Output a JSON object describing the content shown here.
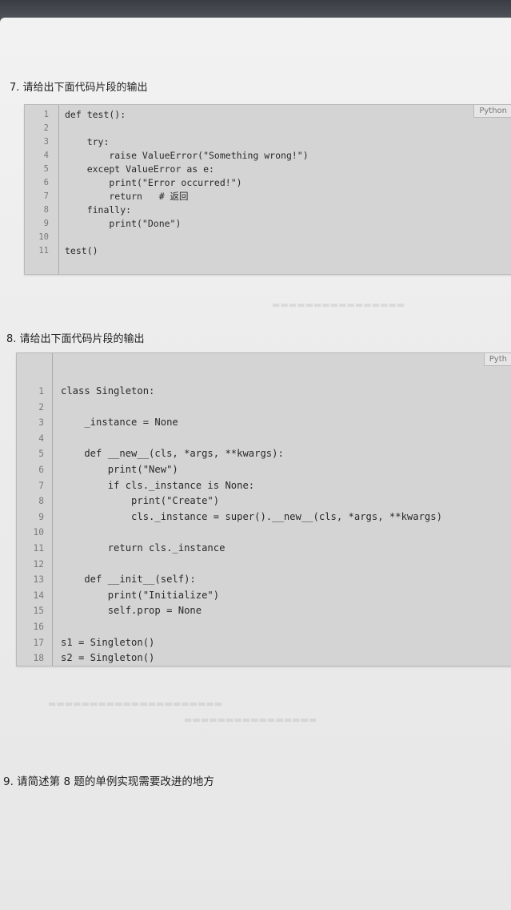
{
  "questions": [
    {
      "title": "7. 请给出下面代码片段的输出",
      "lang": "Python",
      "lines": [
        "def test():",
        "",
        "    try:",
        "        raise ValueError(\"Something wrong!\")",
        "    except ValueError as e:",
        "        print(\"Error occurred!\")",
        "        return   # 返回",
        "    finally:",
        "        print(\"Done\")",
        "",
        "test()"
      ]
    },
    {
      "title": "8. 请给出下面代码片段的输出",
      "lang": "Pyth",
      "lines": [
        "class Singleton:",
        "",
        "    _instance = None",
        "",
        "    def __new__(cls, *args, **kwargs):",
        "        print(\"New\")",
        "        if cls._instance is None:",
        "            print(\"Create\")",
        "            cls._instance = super().__new__(cls, *args, **kwargs)",
        "",
        "        return cls._instance",
        "",
        "    def __init__(self):",
        "        print(\"Initialize\")",
        "        self.prop = None",
        "",
        "s1 = Singleton()",
        "s2 = Singleton()"
      ]
    },
    {
      "title": "9. 请简述第 8 题的单例实现需要改进的地方"
    }
  ]
}
